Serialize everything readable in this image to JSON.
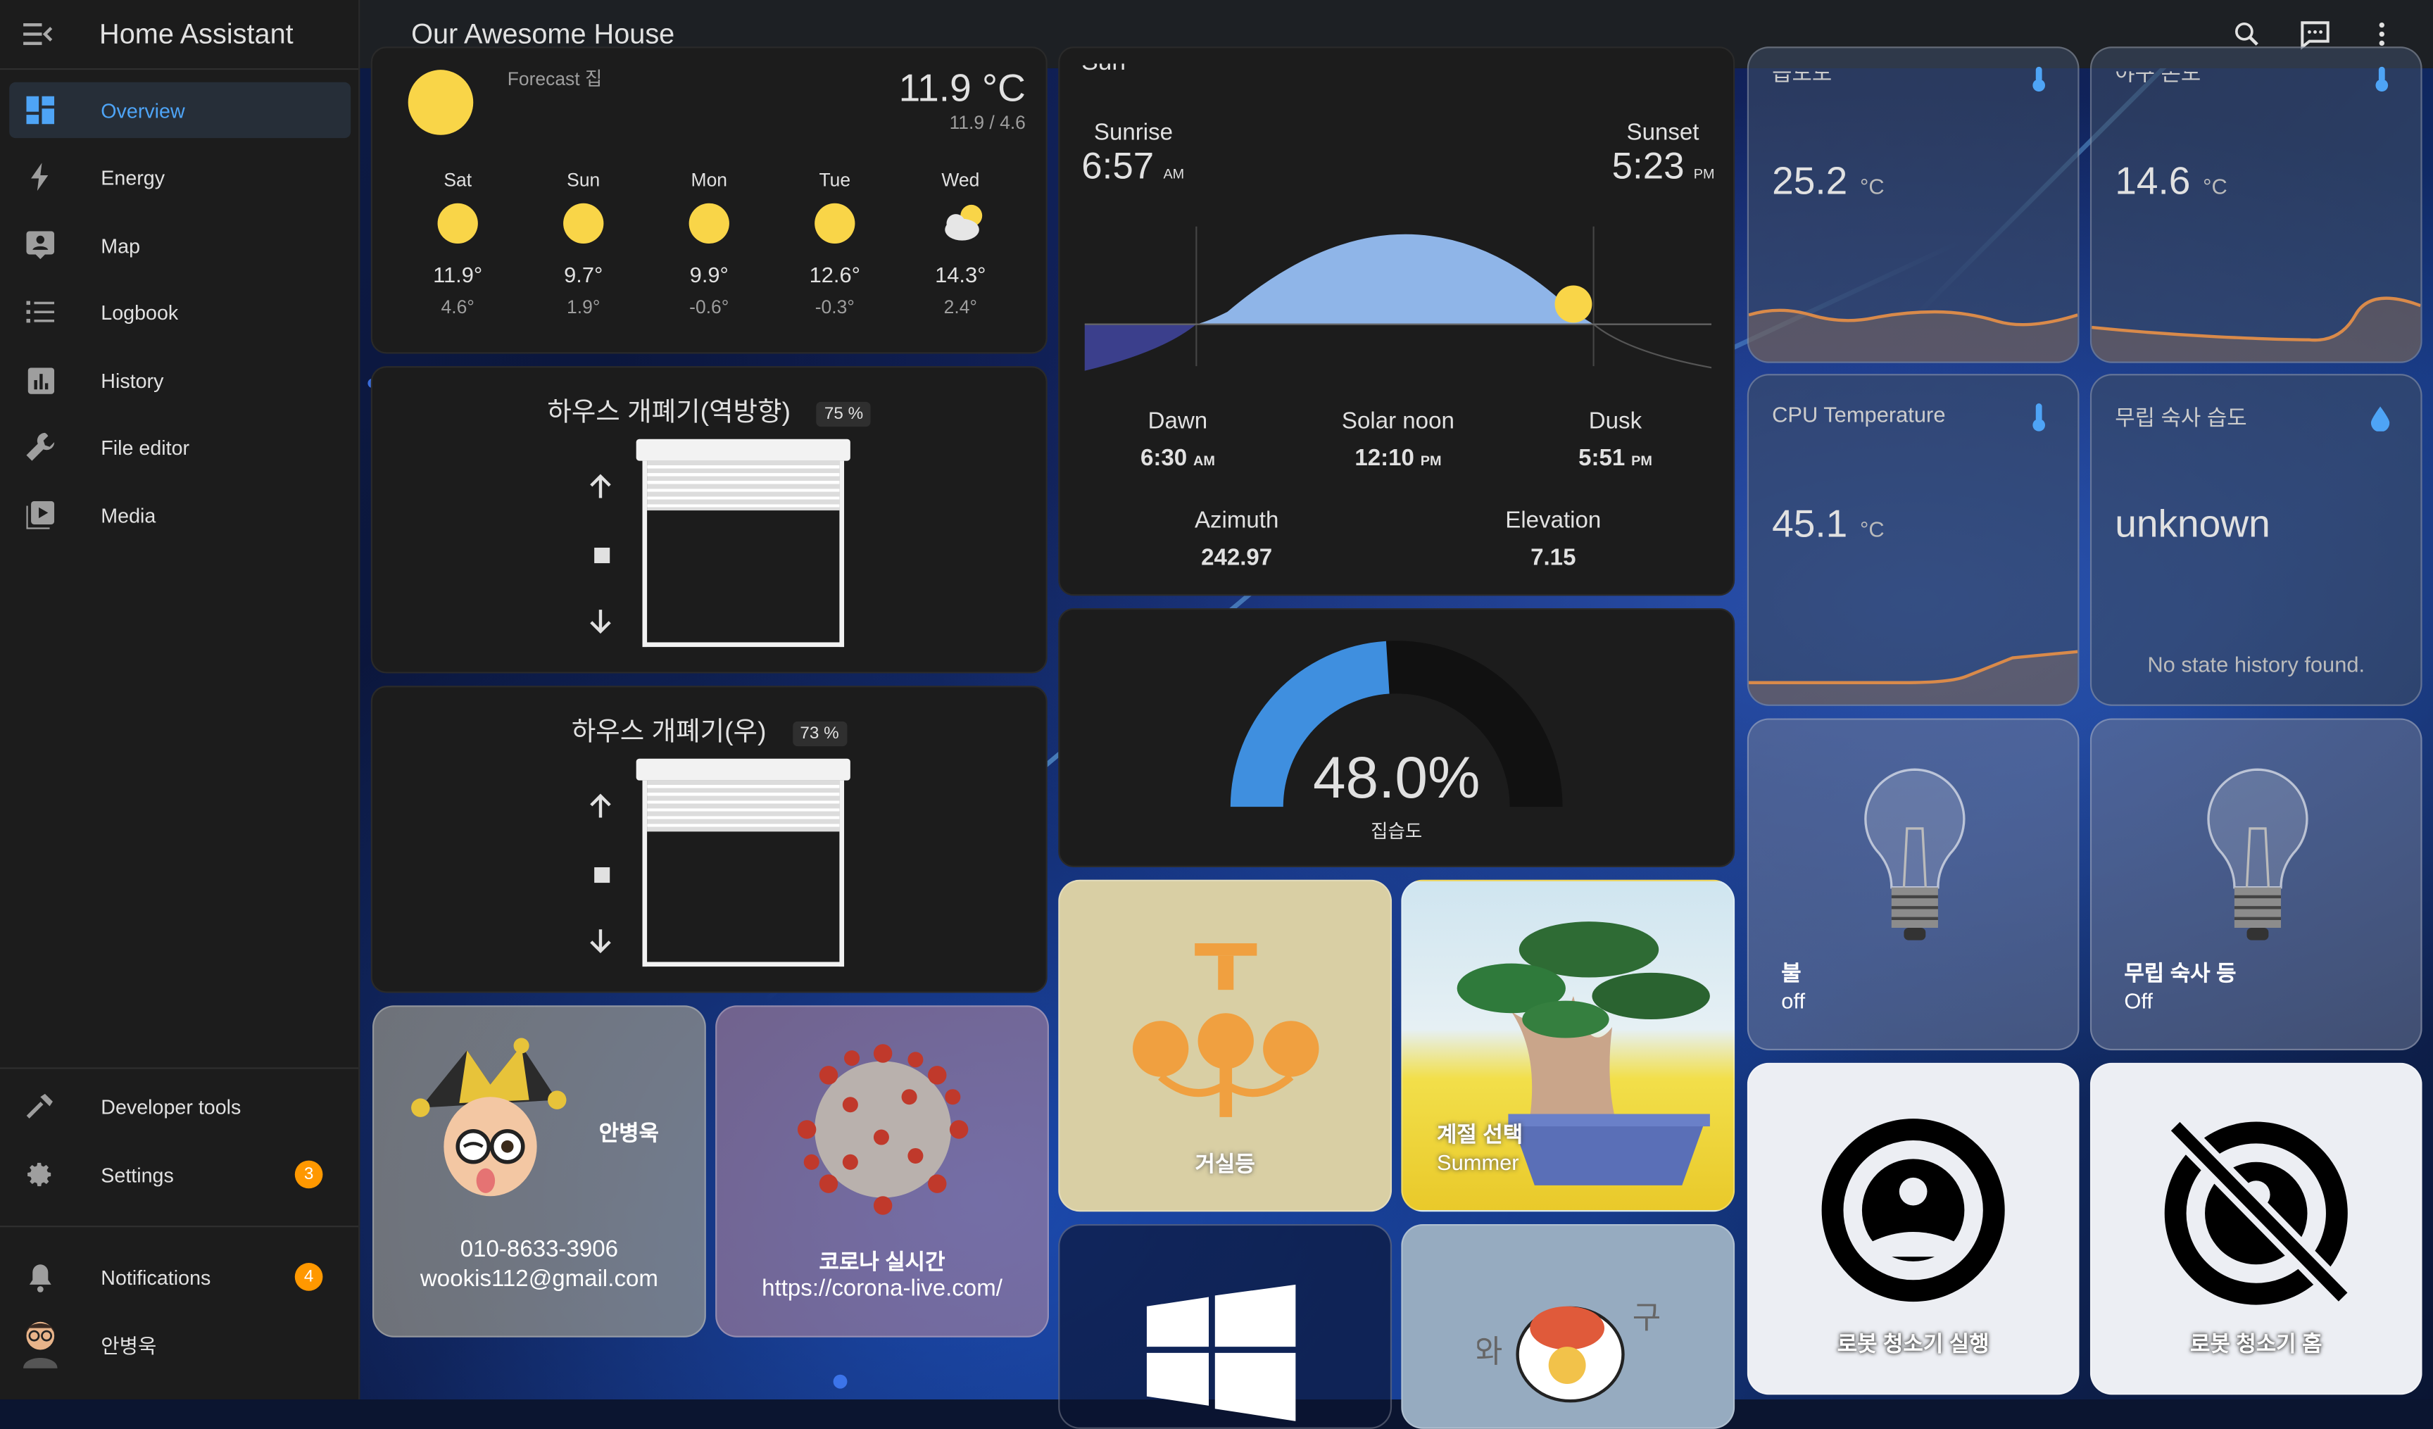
{
  "app": {
    "title": "Home Assistant",
    "dashboard_title": "Our Awesome House"
  },
  "sidebar": {
    "items": [
      {
        "label": "Overview",
        "icon": "dashboard-icon",
        "active": true
      },
      {
        "label": "Energy",
        "icon": "lightning-icon"
      },
      {
        "label": "Map",
        "icon": "map-account-icon"
      },
      {
        "label": "Logbook",
        "icon": "list-icon"
      },
      {
        "label": "History",
        "icon": "chart-box-icon"
      },
      {
        "label": "File editor",
        "icon": "wrench-icon"
      },
      {
        "label": "Media",
        "icon": "play-box-icon"
      }
    ],
    "developer_tools": "Developer tools",
    "settings": {
      "label": "Settings",
      "badge": "3"
    },
    "notifications": {
      "label": "Notifications",
      "badge": "4"
    },
    "user": "안병욱"
  },
  "weather": {
    "forecast_label": "Forecast 집",
    "current_temp": "11.9 °C",
    "hi_lo": "11.9 / 4.6",
    "days": [
      {
        "day": "Sat",
        "hi": "11.9°",
        "lo": "4.6°",
        "icon": "sunny-icon"
      },
      {
        "day": "Sun",
        "hi": "9.7°",
        "lo": "1.9°",
        "icon": "sunny-icon"
      },
      {
        "day": "Mon",
        "hi": "9.9°",
        "lo": "-0.6°",
        "icon": "sunny-icon"
      },
      {
        "day": "Tue",
        "hi": "12.6°",
        "lo": "-0.3°",
        "icon": "sunny-icon"
      },
      {
        "day": "Wed",
        "hi": "14.3°",
        "lo": "2.4°",
        "icon": "partly-cloudy-icon"
      }
    ]
  },
  "cover1": {
    "title": "하우스 개폐기(역방향)",
    "position": "75 %"
  },
  "cover2": {
    "title": "하우스 개폐기(우)",
    "position": "73 %"
  },
  "person": {
    "name": "안병욱",
    "phone": "010-8633-3906",
    "email": "wookis112@gmail.com"
  },
  "corona": {
    "title": "코로나 실시간",
    "url": "https://corona-live.com/"
  },
  "sun": {
    "title": "Sun",
    "sunrise_label": "Sunrise",
    "sunrise_time": "6:57",
    "sunrise_ampm": "AM",
    "sunset_label": "Sunset",
    "sunset_time": "5:23",
    "sunset_ampm": "PM",
    "dawn_label": "Dawn",
    "dawn_time": "6:30",
    "dawn_ampm": "AM",
    "noon_label": "Solar noon",
    "noon_time": "12:10",
    "noon_ampm": "PM",
    "dusk_label": "Dusk",
    "dusk_time": "5:51",
    "dusk_ampm": "PM",
    "azimuth_label": "Azimuth",
    "azimuth_value": "242.97",
    "elevation_label": "Elevation",
    "elevation_value": "7.15"
  },
  "humidity_gauge": {
    "value_text": "48.0%",
    "value": 48.0,
    "label": "집습도",
    "color": "#3f8fdf"
  },
  "tiles": {
    "living_light": {
      "label": "거실등",
      "bg": "#d9cfa4"
    },
    "season": {
      "label": "계절 선택",
      "state": "Summer"
    },
    "light1": {
      "label": "불",
      "state": "off"
    },
    "light2": {
      "label": "무립 숙사 등",
      "state": "Off"
    },
    "robot_run": {
      "label": "로봇 청소기 실행"
    },
    "robot_home": {
      "label": "로봇 청소기 홈"
    }
  },
  "sensors": {
    "s1": {
      "title": "습도도",
      "value": "25.2",
      "unit": "°C"
    },
    "s2": {
      "title": "야구 온도",
      "value": "14.6",
      "unit": "°C"
    },
    "cpu": {
      "title": "CPU Temperature",
      "value": "45.1",
      "unit": "°C"
    },
    "humidity2": {
      "title": "무립 숙사 습도",
      "value": "unknown",
      "note": "No state history found."
    }
  }
}
